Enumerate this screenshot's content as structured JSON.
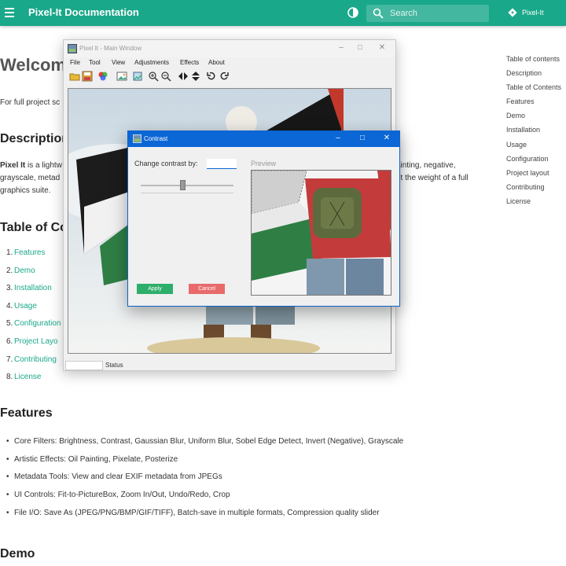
{
  "header": {
    "site_title": "Pixel-It Documentation",
    "search_placeholder": "Search",
    "repo_name": "Pixel-It"
  },
  "doc": {
    "welcome_heading": "Welcome",
    "intro_fragment": "For full project sc",
    "description_heading": "Description",
    "description_lines": [
      {
        "bold": "Pixel It",
        "text": " is a lightw"
      },
      {
        "text": "grayscale, metad"
      },
      {
        "text": "graphics suite."
      }
    ],
    "description_right_lines": [
      "ainting, negative,",
      "ut the weight of a full"
    ],
    "toc_heading": "Table of Co",
    "toc_items": [
      {
        "num": "1.",
        "label": "Features"
      },
      {
        "num": "2.",
        "label": "Demo"
      },
      {
        "num": "3.",
        "label": "Installation"
      },
      {
        "num": "4.",
        "label": "Usage"
      },
      {
        "num": "5.",
        "label": "Configuration"
      },
      {
        "num": "6.",
        "label": "Project Layo"
      },
      {
        "num": "7.",
        "label": "Contributing"
      },
      {
        "num": "8.",
        "label": "License"
      }
    ],
    "features_heading": "Features",
    "features": [
      "Core Filters: Brightness, Contrast, Gaussian Blur, Uniform Blur, Sobel Edge Detect, Invert (Negative), Grayscale",
      "Artistic Effects: Oil Painting, Pixelate, Posterize",
      "Metadata Tools: View and clear EXIF metadata from JPEGs",
      "UI Controls: Fit-to-PictureBox, Zoom In/Out, Undo/Redo, Crop",
      "File I/O: Save As (JPEG/PNG/BMP/GIF/TIFF), Batch-save in multiple formats, Compression quality slider"
    ],
    "demo_heading": "Demo"
  },
  "right_toc": [
    "Table of contents",
    "Description",
    "Table of Contents",
    "Features",
    "Demo",
    "Installation",
    "Usage",
    "Configuration",
    "Project layout",
    "Contributing",
    "License"
  ],
  "main_window": {
    "title": "Pixel It - Main Window",
    "menu": [
      "File",
      "Tool",
      "View",
      "Adjustments",
      "Effects",
      "About"
    ],
    "status_label": "Status"
  },
  "contrast_dialog": {
    "title": "Contrast",
    "label": "Change contrast by:",
    "input_value": "",
    "slider_fraction": 0.45,
    "preview_label": "Preview",
    "apply_label": "Apply",
    "cancel_label": "Cancel"
  },
  "colors": {
    "header": "#1aa88a",
    "link": "#1aa88a",
    "dialog_title": "#0b66d6",
    "apply": "#2eae6b",
    "cancel": "#e86a6a"
  }
}
